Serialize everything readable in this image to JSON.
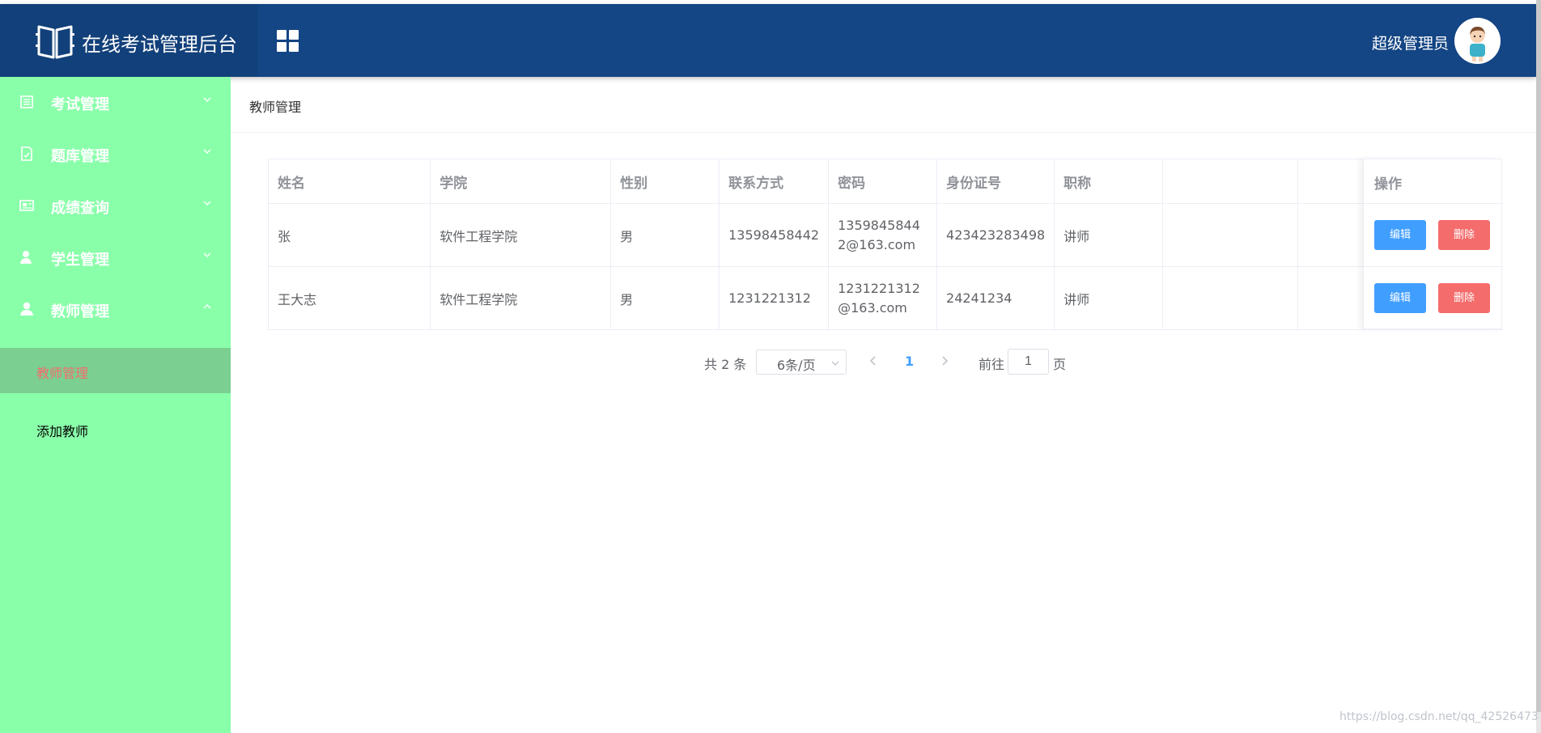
{
  "app": {
    "title": "在线考试管理后台",
    "user_name": "超级管理员"
  },
  "sidebar": {
    "menus": [
      {
        "label": "考试管理",
        "icon": "list-icon",
        "expanded": false
      },
      {
        "label": "题库管理",
        "icon": "document-icon",
        "expanded": false
      },
      {
        "label": "成绩查询",
        "icon": "chart-card-icon",
        "expanded": false
      },
      {
        "label": "学生管理",
        "icon": "user-icon",
        "expanded": false
      },
      {
        "label": "教师管理",
        "icon": "user-solid-icon",
        "expanded": true
      }
    ],
    "sub_items": [
      {
        "label": "教师管理",
        "active": true
      },
      {
        "label": "添加教师",
        "active": false
      }
    ],
    "active_color": "#f56c6c",
    "background": "#8affaa"
  },
  "breadcrumb": {
    "current": "教师管理"
  },
  "table": {
    "headers": [
      "姓名",
      "学院",
      "性别",
      "联系方式",
      "密码",
      "身份证号",
      "职称",
      "",
      "操作"
    ],
    "rows": [
      {
        "name": "张",
        "college": "软件工程学院",
        "gender": "男",
        "phone": "13598458442",
        "password": "13598458442@163.com",
        "id_card": "423423283498",
        "title": "讲师",
        "extra": ""
      },
      {
        "name": "王大志",
        "college": "软件工程学院",
        "gender": "男",
        "phone": "1231221312",
        "password": "1231221312@163.com",
        "id_card": "24241234",
        "title": "讲师",
        "extra": ""
      }
    ],
    "edit_label": "编辑",
    "delete_label": "删除"
  },
  "pagination": {
    "total_text": "共 2 条",
    "page_size": "6条/页",
    "current_page": "1",
    "goto_prefix": "前往",
    "goto_value": "1",
    "goto_suffix": "页"
  },
  "watermark": "https://blog.csdn.net/qq_42526473",
  "colors": {
    "header": "#144584",
    "primary": "#409eff",
    "danger": "#f56c6c"
  }
}
